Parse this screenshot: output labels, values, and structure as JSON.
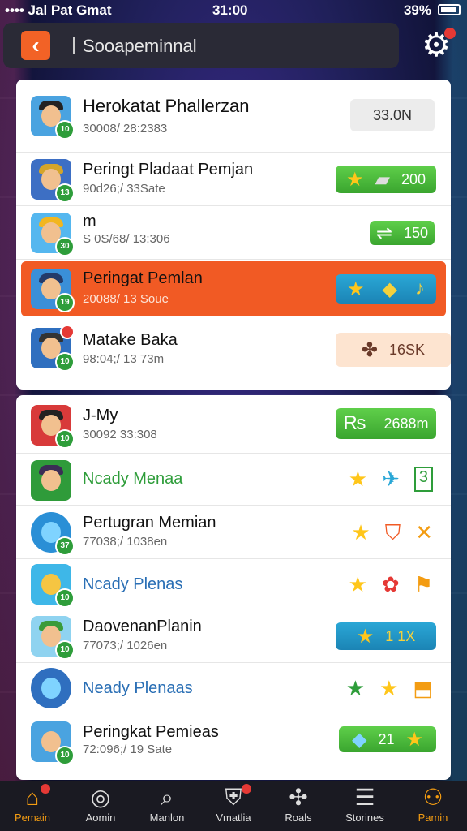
{
  "status": {
    "left": "•••• Jal Pat Gmat",
    "time": "31:00",
    "battery": "39%"
  },
  "header": {
    "back_icon": "‹",
    "title": "Sooapeminnal"
  },
  "top_list": [
    {
      "name": "Herokatat Phallerzan",
      "sub": "30008/ 28:2383",
      "level": "10",
      "value": "33.0N",
      "value_style": "gray"
    },
    {
      "name": "Peringt Pladaat Pemjan",
      "sub": "90d26;/ 33Sate",
      "level": "13",
      "value": "200",
      "value_style": "green"
    },
    {
      "name": "m",
      "sub": "S 0S/68/ 13:306",
      "level": "30",
      "value": "150",
      "value_style": "green"
    },
    {
      "name": "Peringat Pemlan",
      "sub": "20088/ 13 Soue",
      "level": "19",
      "value": "",
      "value_style": "blue"
    },
    {
      "name": "Matake Baka",
      "sub": "98:04;/ 13 73m",
      "level": "10",
      "value": "16SK",
      "value_style": "peach"
    }
  ],
  "bottom_list": [
    {
      "name": "J-My",
      "sub": "30092 33:308",
      "level": "10",
      "value": "2688m",
      "value_style": "green"
    },
    {
      "name": "Ncady Menaa",
      "sub": "",
      "level": "",
      "value": "3",
      "value_style": "icons"
    },
    {
      "name": "Pertugran Memian",
      "sub": "77038;/ 1038en",
      "level": "37",
      "value": "",
      "value_style": "icons"
    },
    {
      "name": "Ncady Plenas",
      "sub": "",
      "level": "10",
      "value": "",
      "value_style": "icons"
    },
    {
      "name": "DaovenanPlanin",
      "sub": "77073;/ 1026en",
      "level": "10",
      "value": "1  1X",
      "value_style": "blue"
    },
    {
      "name": "Neady Plenaas",
      "sub": "",
      "level": "",
      "value": "",
      "value_style": "icons"
    },
    {
      "name": "Peringkat Pemieas",
      "sub": "72:096;/ 19 Sate",
      "level": "10",
      "value": "21",
      "value_style": "green"
    }
  ],
  "nav": [
    {
      "label": "Pemain",
      "icon": "home-icon"
    },
    {
      "label": "Aomin",
      "icon": "target-icon"
    },
    {
      "label": "Manlon",
      "icon": "search-icon"
    },
    {
      "label": "Vmatlia",
      "icon": "shield-icon"
    },
    {
      "label": "Roals",
      "icon": "fan-icon"
    },
    {
      "label": "Storines",
      "icon": "list-icon"
    },
    {
      "label": "Pamin",
      "icon": "people-icon"
    }
  ]
}
